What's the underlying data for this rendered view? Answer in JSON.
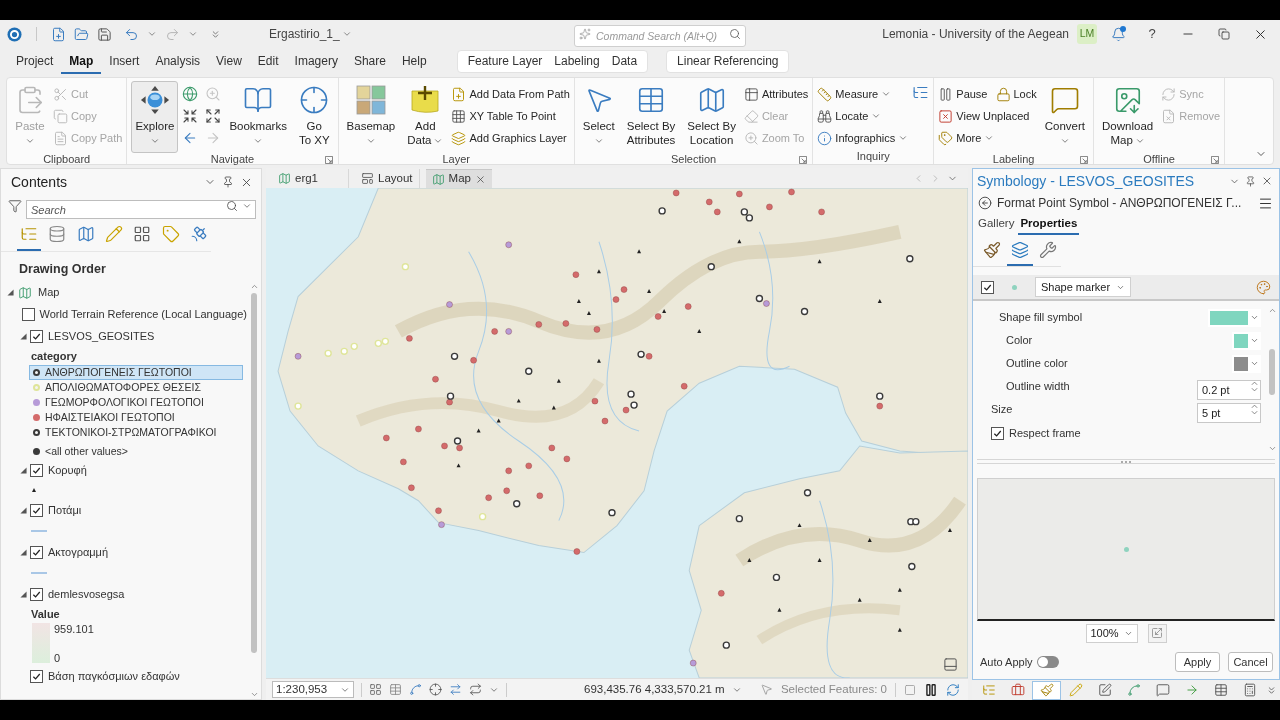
{
  "title_bar": {
    "project": "Ergastirio_1_",
    "command_search": {
      "placeholder": "Command Search (Alt+Q)"
    },
    "account": "Lemonia - University of the Aegean",
    "initials": "LM",
    "help": "?"
  },
  "ribbon_tabs": [
    {
      "label": "Project",
      "selected": false
    },
    {
      "label": "Map",
      "selected": true
    },
    {
      "label": "Insert",
      "selected": false
    },
    {
      "label": "Analysis",
      "selected": false
    },
    {
      "label": "View",
      "selected": false
    },
    {
      "label": "Edit",
      "selected": false
    },
    {
      "label": "Imagery",
      "selected": false
    },
    {
      "label": "Share",
      "selected": false
    },
    {
      "label": "Help",
      "selected": false
    }
  ],
  "contextual_tabs": [
    {
      "tabs": [
        {
          "label": "Feature Layer",
          "selected": false
        },
        {
          "label": "Labeling",
          "selected": false
        },
        {
          "label": "Data",
          "selected": false
        }
      ]
    },
    {
      "tabs": [
        {
          "label": "Linear Referencing",
          "selected": false
        }
      ]
    }
  ],
  "ribbon_groups": [
    {
      "label": "Clipboard",
      "launcher": false,
      "items": [
        {
          "kind": "large",
          "label": "Paste",
          "caret": true,
          "disabled": true,
          "pressed": false
        },
        {
          "kind": "stack",
          "rows": [
            [
              {
                "label": "Cut",
                "caret": false,
                "disabled": true
              }
            ],
            [
              {
                "label": "Copy",
                "caret": false,
                "disabled": true
              }
            ],
            [
              {
                "label": "Copy Path",
                "caret": false,
                "disabled": true
              }
            ]
          ]
        }
      ]
    },
    {
      "label": "Navigate",
      "launcher": true,
      "items": [
        {
          "kind": "large",
          "label": "Explore",
          "caret": true,
          "disabled": false,
          "pressed": true
        },
        {
          "kind": "icon_grid",
          "buttons": [
            {
              "disabled": false
            },
            {
              "disabled": true
            },
            {
              "disabled": false
            },
            {
              "disabled": false
            },
            {
              "disabled": false
            },
            {
              "disabled": true
            }
          ]
        },
        {
          "kind": "large",
          "label": "Bookmarks",
          "caret": true,
          "disabled": false,
          "pressed": false
        },
        {
          "kind": "large",
          "label": "Go\nTo XY",
          "caret": false,
          "disabled": false,
          "pressed": false
        }
      ]
    },
    {
      "label": "Layer",
      "launcher": false,
      "items": [
        {
          "kind": "large",
          "label": "Basemap",
          "caret": true,
          "disabled": false,
          "pressed": false
        },
        {
          "kind": "large",
          "label": "Add\nData",
          "caret": true,
          "disabled": false,
          "pressed": false
        },
        {
          "kind": "stack",
          "rows": [
            [
              {
                "label": "Add Data From Path",
                "caret": false,
                "disabled": false
              }
            ],
            [
              {
                "label": "XY Table To Point",
                "caret": false,
                "disabled": false
              }
            ],
            [
              {
                "label": "Add Graphics Layer",
                "caret": false,
                "disabled": false
              }
            ]
          ]
        }
      ]
    },
    {
      "label": "Selection",
      "launcher": true,
      "items": [
        {
          "kind": "large",
          "label": "Select",
          "caret": true,
          "disabled": false,
          "pressed": false
        },
        {
          "kind": "large",
          "label": "Select By\nAttributes",
          "caret": false,
          "disabled": false,
          "pressed": false
        },
        {
          "kind": "large",
          "label": "Select By\nLocation",
          "caret": false,
          "disabled": false,
          "pressed": false
        },
        {
          "kind": "stack",
          "rows": [
            [
              {
                "label": "Attributes",
                "caret": false,
                "disabled": false
              }
            ],
            [
              {
                "label": "Clear",
                "caret": false,
                "disabled": true
              }
            ],
            [
              {
                "label": "Zoom To",
                "caret": false,
                "disabled": true
              }
            ]
          ]
        }
      ]
    },
    {
      "label": "Inquiry",
      "launcher": false,
      "items": [
        {
          "kind": "stack",
          "rows": [
            [
              {
                "label": "Measure",
                "caret": true,
                "disabled": false
              }
            ],
            [
              {
                "label": "Locate",
                "caret": true,
                "disabled": false
              }
            ],
            [
              {
                "label": "Infographics",
                "caret": true,
                "disabled": false
              }
            ]
          ]
        },
        {
          "kind": "icon"
        }
      ]
    },
    {
      "label": "Labeling",
      "launcher": true,
      "items": [
        {
          "kind": "stack",
          "rows": [
            [
              {
                "label": "Pause",
                "caret": false,
                "disabled": false
              },
              {
                "label": "Lock",
                "caret": false,
                "disabled": false
              }
            ],
            [
              {
                "label": "View Unplaced",
                "caret": false,
                "disabled": false
              }
            ],
            [
              {
                "label": "More",
                "caret": true,
                "disabled": false
              }
            ]
          ]
        },
        {
          "kind": "large",
          "label": "Convert",
          "caret": true,
          "disabled": false,
          "pressed": false
        }
      ]
    },
    {
      "label": "Offline",
      "launcher": true,
      "items": [
        {
          "kind": "large",
          "label": "Download\nMap",
          "caret": true,
          "disabled": false,
          "pressed": false
        },
        {
          "kind": "stack",
          "rows": [
            [
              {
                "label": "Sync",
                "caret": false,
                "disabled": true
              }
            ],
            [
              {
                "label": "Remove",
                "caret": false,
                "disabled": true
              }
            ]
          ]
        }
      ]
    }
  ],
  "contents": {
    "title": "Contents",
    "search": {
      "placeholder": "Search"
    },
    "views": [
      {
        "selected": true
      },
      {
        "selected": false
      },
      {
        "selected": false
      },
      {
        "selected": false
      },
      {
        "selected": false
      },
      {
        "selected": false
      },
      {
        "selected": false
      }
    ],
    "heading": "Drawing Order",
    "tree": {
      "name": "Map",
      "expanded": true,
      "children": [
        {
          "name": "World Terrain Reference (Local Language)",
          "checked": false
        },
        {
          "name": "LESVOS_GEOSITES",
          "checked": true,
          "expanded": true,
          "legend": {
            "kind": "classes",
            "heading": "category",
            "classes": [
              {
                "label": "ΑΝΘΡΩΠΟΓΕΝΕΙΣ ΓΕΩΤΟΠΟΙ",
                "color": "#3a3a3a",
                "hollow": true,
                "selected": true
              },
              {
                "label": "ΑΠΟΛΙΘΩΜΑΤΟΦΟΡΕΣ ΘΕΣΕΙΣ",
                "color": "#dfe59a",
                "hollow": true,
                "selected": false
              },
              {
                "label": "ΓΕΩΜΟΡΦΟΛΟΓΙΚΟΙ ΓΕΩΤΟΠΟΙ",
                "color": "#b79bd8",
                "hollow": false,
                "selected": false
              },
              {
                "label": "ΗΦΑΙΣΤΕΙΑΚΟΙ ΓΕΩΤΟΠΟΙ",
                "color": "#d46b6b",
                "hollow": false,
                "selected": false
              },
              {
                "label": "ΤΕΚΤΟΝΙΚΟΙ-ΣΤΡΩΜΑΤΟΓΡΑΦΙΚΟΙ",
                "color": "#3a3a3a",
                "hollow": true,
                "selected": false
              },
              {
                "label": "<all other values>",
                "color": "#3a3a3a",
                "hollow": false,
                "selected": false
              }
            ]
          }
        },
        {
          "name": "Κορυφή",
          "checked": true,
          "expanded": true,
          "legend": {
            "kind": "triangle"
          }
        },
        {
          "name": "Ποτάμι",
          "checked": true,
          "expanded": true,
          "legend": {
            "kind": "line"
          }
        },
        {
          "name": "Ακτογραμμή",
          "checked": true,
          "expanded": true,
          "legend": {
            "kind": "line"
          }
        },
        {
          "name": "demlesvosegsa",
          "checked": true,
          "expanded": true,
          "legend": {
            "kind": "ramp",
            "heading": "Value",
            "high": "959.101",
            "low": "0"
          }
        },
        {
          "name": "Βάση παγκόσμιων εδαφών",
          "checked": true
        }
      ]
    }
  },
  "map_view": {
    "tabs": [
      {
        "label": "erg1",
        "kind": "map",
        "selected": false
      },
      {
        "label": "Layout",
        "kind": "layout",
        "selected": false
      },
      {
        "label": "Map",
        "kind": "map",
        "selected": true
      }
    ],
    "scale": "1:230,953",
    "coordinates": "693,435.76 4,333,570.21 m",
    "selected_features": "Selected Features: 0"
  },
  "symbology": {
    "title": "Symbology - LESVOS_GEOSITES",
    "subtitle": "Format Point Symbol - ΑΝΘΡΩΠΟΓΕΝΕΙΣ Γ...",
    "tabs": [
      {
        "label": "Gallery",
        "selected": false
      },
      {
        "label": "Properties",
        "selected": true
      }
    ],
    "icon_tabs": [
      {
        "selected": false
      },
      {
        "selected": true
      },
      {
        "selected": false
      }
    ],
    "layer": {
      "checked": true,
      "color": "#8fd3bf",
      "type": "Shape marker"
    },
    "properties": [
      {
        "kind": "color",
        "label": "Shape fill symbol",
        "color": "#7fd6bf",
        "children": [
          {
            "kind": "color",
            "label": "Color",
            "color": "#7fd6bf"
          },
          {
            "kind": "color",
            "label": "Outline color",
            "color": "#8c8c8c"
          },
          {
            "kind": "number",
            "label": "Outline width",
            "value": "0.2 pt"
          }
        ]
      },
      {
        "kind": "number",
        "label": "Size",
        "value": "5 pt"
      },
      {
        "kind": "checkbox",
        "label": "Respect frame",
        "checked": true
      }
    ],
    "zoom": "100%",
    "auto_apply": {
      "label": "Auto Apply",
      "on": false
    },
    "buttons": [
      "Apply",
      "Cancel"
    ]
  },
  "pane_toolbar": [
    {
      "selected": false
    },
    {
      "selected": false
    },
    {
      "selected": true
    },
    {
      "selected": false
    },
    {
      "selected": false
    },
    {
      "selected": false
    },
    {
      "selected": false
    },
    {
      "selected": false
    },
    {
      "selected": false
    },
    {
      "selected": false
    }
  ]
}
